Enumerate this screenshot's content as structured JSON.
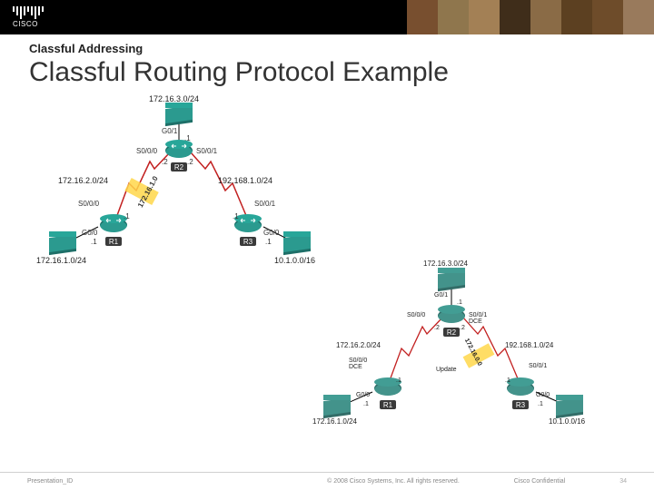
{
  "slide": {
    "kicker": "Classful Addressing",
    "title": "Classful Routing Protocol Example",
    "presentation_id": "Presentation_ID",
    "copyright": "© 2008 Cisco Systems, Inc. All rights reserved.",
    "confidential": "Cisco Confidential",
    "page_no": "34"
  },
  "diagramA": {
    "routers": {
      "R1": "R1",
      "R2": "R2",
      "R3": "R3"
    },
    "nets": {
      "r2_top": "172.16.3.0/24",
      "r2_left": "172.16.2.0/24",
      "r2_right": "192.168.1.0/24",
      "r1_left": "172.16.1.0/24",
      "r3_right": "10.1.0.0/16",
      "update_left": "172.16.1.0"
    },
    "iface": {
      "g00": "G0/0",
      "g01": "G0/1",
      "s000": "S0/0/0",
      "s001": "S0/0/1"
    },
    "ip": {
      "dot1": ".1",
      "dot2": ".2"
    }
  },
  "diagramB": {
    "routers": {
      "R1": "R1",
      "R2": "R2",
      "R3": "R3"
    },
    "nets": {
      "r2_top": "172.16.3.0/24",
      "r2_left": "172.16.2.0/24",
      "r2_right": "192.168.1.0/24",
      "r1_left": "172.16.1.0/24",
      "r3_right": "10.1.0.0/16",
      "update_right": "172.16.0.0",
      "update_label": "Update"
    },
    "iface": {
      "g00": "G0/0",
      "g01": "G0/1",
      "s000": "S0/0/0",
      "s001": "S0/0/1",
      "s000dce": "S0/0/0\nDCE",
      "s001dce": "S0/0/1\nDCE"
    },
    "ip": {
      "dot1": ".1",
      "dot2": ".2"
    }
  }
}
